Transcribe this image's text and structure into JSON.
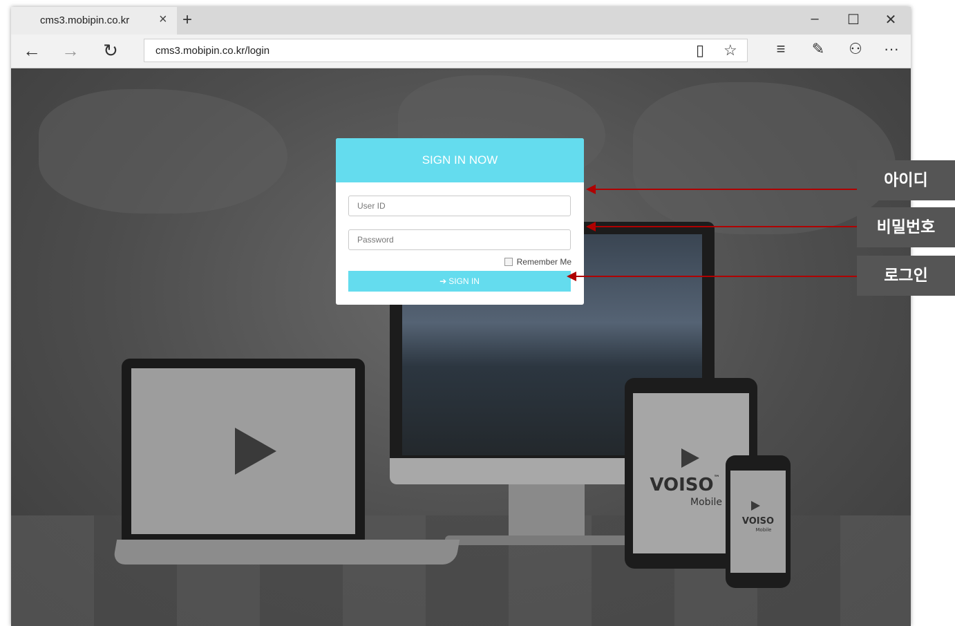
{
  "browser": {
    "tab_title": "cms3.mobipin.co.kr",
    "tab_close": "×",
    "new_tab": "+",
    "minimize": "–",
    "maximize": "☐",
    "close": "✕",
    "back": "←",
    "forward": "→",
    "refresh": "↻",
    "url": "cms3.mobipin.co.kr/login",
    "reading_view": "▯",
    "favorite": "☆",
    "hub": "≡",
    "web_note": "✎",
    "share": "⚇",
    "more": "···"
  },
  "login": {
    "title": "SIGN IN NOW",
    "user_id_placeholder": "User ID",
    "password_placeholder": "Password",
    "remember_label": "Remember Me",
    "sign_in_label": "SIGN IN",
    "sign_in_icon": "➔"
  },
  "devices": {
    "brand": "VOISO",
    "brand_tm": "™",
    "brand_sub": "Mobile"
  },
  "annotations": {
    "user_id_label": "아이디",
    "password_label": "비밀번호",
    "login_label": "로그인"
  },
  "colors": {
    "accent": "#64dcee",
    "annotation_arrow": "#b00000",
    "annotation_label_bg": "#555555"
  }
}
